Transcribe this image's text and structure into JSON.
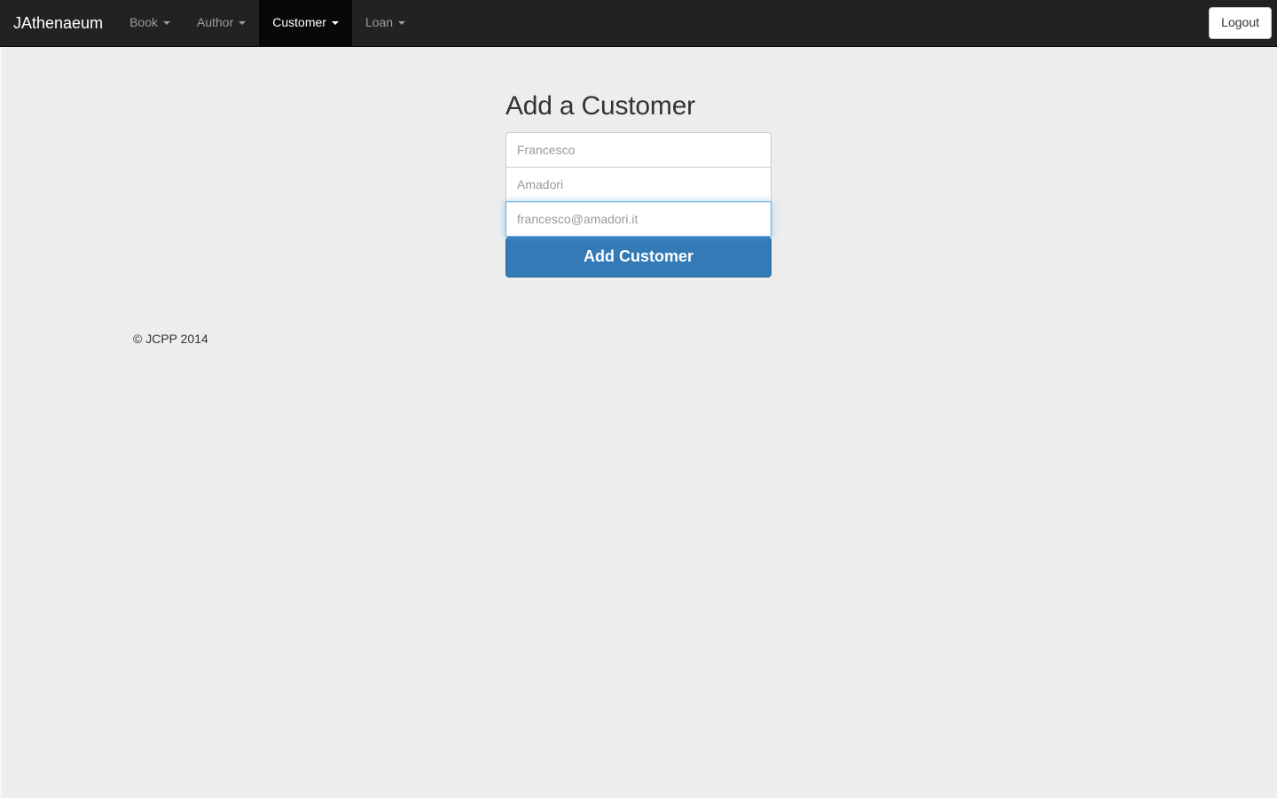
{
  "navbar": {
    "brand": "JAthenaeum",
    "items": [
      {
        "label": "Book",
        "has_caret": true,
        "active": false
      },
      {
        "label": "Author",
        "has_caret": true,
        "active": false
      },
      {
        "label": "Customer",
        "has_caret": true,
        "active": true
      },
      {
        "label": "Loan",
        "has_caret": true,
        "active": false
      }
    ],
    "logout_label": "Logout",
    "background_color": "#222222",
    "active_background_color": "#080808",
    "link_color": "#9d9d9d"
  },
  "main": {
    "title": "Add a Customer",
    "form": {
      "fields": [
        {
          "name": "firstname",
          "value": "Francesco",
          "placeholder": "Francesco",
          "focused": false
        },
        {
          "name": "lastname",
          "value": "Amadori",
          "placeholder": "Amadori",
          "focused": false
        },
        {
          "name": "email",
          "value": "francesco@amadori.it",
          "placeholder": "francesco@amadori.it",
          "focused": true
        }
      ],
      "submit_label": "Add Customer",
      "submit_color": "#337ab7"
    }
  },
  "footer": {
    "copyright": "© JCPP 2014"
  }
}
